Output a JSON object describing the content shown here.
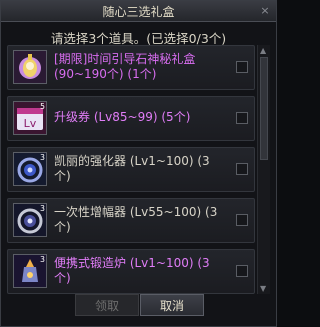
{
  "dialog": {
    "title": "随心三选礼盒",
    "close_label": "×",
    "prompt": "请选择3个道具。(已选择0/3个)"
  },
  "items": [
    {
      "name": "[期限]时间引导石神秘礼盒 (90~190个) (1个)",
      "color": "#d86df0",
      "badge": "",
      "icon": "gift-box-icon"
    },
    {
      "name": "升级券 (Lv85~99) (5个)",
      "color": "#e07df7",
      "badge": "5",
      "icon": "level-ticket-icon"
    },
    {
      "name": "凯丽的强化器 (Lv1~100) (3个)",
      "color": "#d8d4c8",
      "badge": "3",
      "icon": "enhancer-icon"
    },
    {
      "name": "一次性增幅器 (Lv55~100) (3个)",
      "color": "#d8d4c8",
      "badge": "3",
      "icon": "amplifier-icon"
    },
    {
      "name": "便携式锻造炉 (Lv1~100) (3个)",
      "color": "#e07df7",
      "badge": "3",
      "icon": "forge-icon"
    }
  ],
  "buttons": {
    "claim": "领取",
    "cancel": "取消"
  },
  "colors": {
    "rare": "#e07df7",
    "common": "#d8d4c8"
  }
}
